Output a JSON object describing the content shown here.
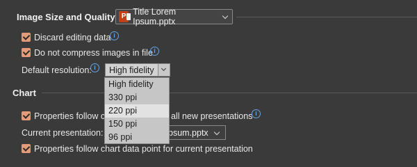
{
  "image_section": {
    "title": "Image Size and Quality",
    "file_select_value": "Title Lorem Ipsum.pptx",
    "file_icon_letter": "P",
    "discard_label": "Discard editing data",
    "no_compress_label": "Do not compress images in file",
    "default_resolution_label": "Default resolution:",
    "resolution_selected": "High fidelity",
    "resolution_options": [
      "High fidelity",
      "330 ppi",
      "220 ppi",
      "150 ppi",
      "96 ppi"
    ],
    "info_glyph": "i"
  },
  "chart_section": {
    "title": "Chart",
    "follow_all_prefix": "Properties follow ch",
    "follow_all_suffix": "all new presentations",
    "current_presentation_label": "Current presentation:",
    "current_presentation_value": "psum.pptx",
    "follow_current_label": "Properties follow chart data point for current presentation"
  },
  "colors": {
    "background": "#3a3a3a",
    "checkbox_accent": "#e59b79",
    "info_blue": "#63a3e6",
    "powerpoint_red": "#c43e1c"
  }
}
